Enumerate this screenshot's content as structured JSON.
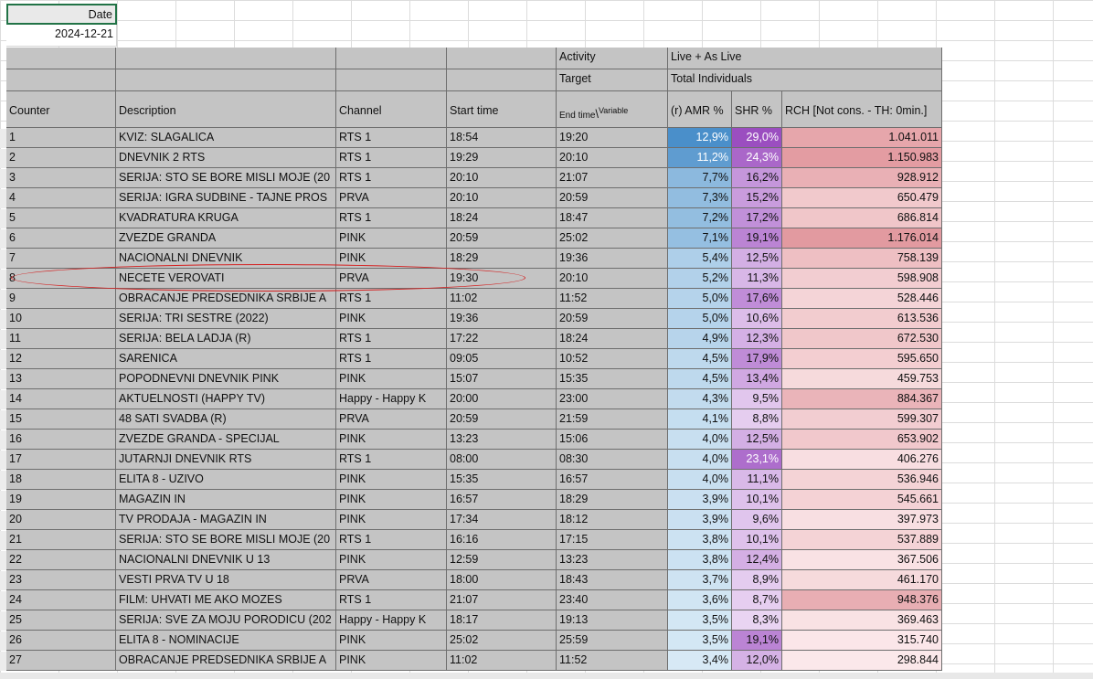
{
  "date_label": "Date",
  "date_value": "2024-12-21",
  "header": {
    "activity_label": "Activity",
    "activity_value": "Live + As Live",
    "target_label": "Target",
    "target_value": "Total Individuals",
    "columns": [
      "Counter",
      "Description",
      "Channel",
      "Start time",
      "End time",
      "Variable",
      "(r) AMR %",
      "SHR %",
      "RCH [Not cons. - TH: 0min.]"
    ]
  },
  "rows": [
    [
      "1",
      "KVIZ: SLAGALICA",
      "RTS 1",
      "18:54",
      "19:20",
      "12,9%",
      "29,0%",
      "1.041.011"
    ],
    [
      "2",
      "DNEVNIK 2 RTS",
      "RTS 1",
      "19:29",
      "20:10",
      "11,2%",
      "24,3%",
      "1.150.983"
    ],
    [
      "3",
      "SERIJA: STO SE BORE MISLI MOJE (20",
      "RTS 1",
      "20:10",
      "21:07",
      "7,7%",
      "16,2%",
      "928.912"
    ],
    [
      "4",
      "SERIJA: IGRA SUDBINE - TAJNE PROS",
      "PRVA",
      "20:10",
      "20:59",
      "7,3%",
      "15,2%",
      "650.479"
    ],
    [
      "5",
      "KVADRATURA KRUGA",
      "RTS 1",
      "18:24",
      "18:47",
      "7,2%",
      "17,2%",
      "686.814"
    ],
    [
      "6",
      "ZVEZDE GRANDA",
      "PINK",
      "20:59",
      "25:02",
      "7,1%",
      "19,1%",
      "1.176.014"
    ],
    [
      "7",
      "NACIONALNI DNEVNIK",
      "PINK",
      "18:29",
      "19:36",
      "5,4%",
      "12,5%",
      "758.139"
    ],
    [
      "8",
      "NECETE VEROVATI",
      "PRVA",
      "19:30",
      "20:10",
      "5,2%",
      "11,3%",
      "598.908"
    ],
    [
      "9",
      "OBRACANJE PREDSEDNIKA SRBIJE A",
      "RTS 1",
      "11:02",
      "11:52",
      "5,0%",
      "17,6%",
      "528.446"
    ],
    [
      "10",
      "SERIJA: TRI SESTRE (2022)",
      "PINK",
      "19:36",
      "20:59",
      "5,0%",
      "10,6%",
      "613.536"
    ],
    [
      "11",
      "SERIJA: BELA LADJA (R)",
      "RTS 1",
      "17:22",
      "18:24",
      "4,9%",
      "12,3%",
      "672.530"
    ],
    [
      "12",
      "SARENICA",
      "RTS 1",
      "09:05",
      "10:52",
      "4,5%",
      "17,9%",
      "595.650"
    ],
    [
      "13",
      "POPODNEVNI DNEVNIK PINK",
      "PINK",
      "15:07",
      "15:35",
      "4,5%",
      "13,4%",
      "459.753"
    ],
    [
      "14",
      "AKTUELNOSTI (HAPPY TV)",
      "Happy - Happy K",
      "20:00",
      "23:00",
      "4,3%",
      "9,5%",
      "884.367"
    ],
    [
      "15",
      "48 SATI SVADBA (R)",
      "PRVA",
      "20:59",
      "21:59",
      "4,1%",
      "8,8%",
      "599.307"
    ],
    [
      "16",
      "ZVEZDE GRANDA - SPECIJAL",
      "PINK",
      "13:23",
      "15:06",
      "4,0%",
      "12,5%",
      "653.902"
    ],
    [
      "17",
      "JUTARNJI DNEVNIK RTS",
      "RTS 1",
      "08:00",
      "08:30",
      "4,0%",
      "23,1%",
      "406.276"
    ],
    [
      "18",
      "ELITA 8 - UZIVO",
      "PINK",
      "15:35",
      "16:57",
      "4,0%",
      "11,1%",
      "536.946"
    ],
    [
      "19",
      "MAGAZIN IN",
      "PINK",
      "16:57",
      "18:29",
      "3,9%",
      "10,1%",
      "545.661"
    ],
    [
      "20",
      "TV PRODAJA - MAGAZIN IN",
      "PINK",
      "17:34",
      "18:12",
      "3,9%",
      "9,6%",
      "397.973"
    ],
    [
      "21",
      "SERIJA: STO SE BORE MISLI MOJE (20",
      "RTS 1",
      "16:16",
      "17:15",
      "3,8%",
      "10,1%",
      "537.889"
    ],
    [
      "22",
      "NACIONALNI DNEVNIK U 13",
      "PINK",
      "12:59",
      "13:23",
      "3,8%",
      "12,4%",
      "367.506"
    ],
    [
      "23",
      "VESTI PRVA TV U 18",
      "PRVA",
      "18:00",
      "18:43",
      "3,7%",
      "8,9%",
      "461.170"
    ],
    [
      "24",
      "FILM: UHVATI ME AKO MOZES",
      "RTS 1",
      "21:07",
      "23:40",
      "3,6%",
      "8,7%",
      "948.376"
    ],
    [
      "25",
      "SERIJA: SVE ZA MOJU PORODICU (202",
      "Happy - Happy K",
      "18:17",
      "19:13",
      "3,5%",
      "8,3%",
      "369.463"
    ],
    [
      "26",
      "ELITA 8 - NOMINACIJE",
      "PINK",
      "25:02",
      "25:59",
      "3,5%",
      "19,1%",
      "315.740"
    ],
    [
      "27",
      "OBRACANJE PREDSEDNIKA SRBIJE A",
      "PINK",
      "11:02",
      "11:52",
      "3,4%",
      "12,0%",
      "298.844"
    ]
  ],
  "colors": {
    "header_gray": "#c4c4c4",
    "amr_high": "#4a8fca",
    "amr_low": "#d7e9f5",
    "shr_high": "#9b4ec0",
    "shr_low": "#e9d4f2",
    "rch_high": "#e29aa0",
    "rch_low": "#fbe8ea",
    "annotation": "#d42020"
  }
}
